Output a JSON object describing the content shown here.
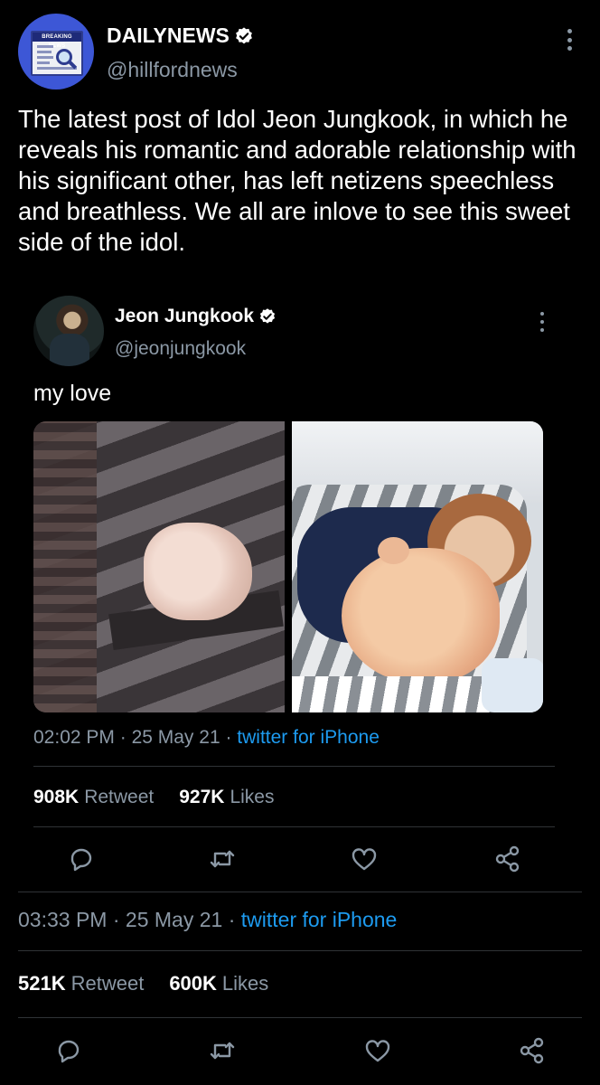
{
  "outer_tweet": {
    "avatar_banner": "BREAKING NEWS",
    "display_name": "DAILYNEWS",
    "handle": "@hillfordnews",
    "text": "The latest post of Idol Jeon Jungkook, in which he reveals his romantic and adorable relationship with his significant other, has left netizens speechless and breathless. We all are inlove to see this sweet side of the idol.",
    "time": "03:33 PM",
    "date": "25 May 21",
    "source": "twitter for iPhone",
    "retweet_count": "521K",
    "retweet_label": "Retweet",
    "like_count": "600K",
    "like_label": "Likes"
  },
  "quoted_tweet": {
    "display_name": "Jeon Jungkook",
    "handle": "@jeonjungkook",
    "text": "my love",
    "time": "02:02 PM",
    "date": "25 May 21",
    "source": "twitter for iPhone",
    "retweet_count": "908K",
    "retweet_label": "Retweet",
    "like_count": "927K",
    "like_label": "Likes"
  },
  "icons": [
    "verified-badge-icon",
    "more-options-icon",
    "reply-icon",
    "retweet-icon",
    "like-icon",
    "share-icon"
  ],
  "colors": {
    "background": "#000000",
    "text": "#ffffff",
    "secondary_text": "#8b98a5",
    "link": "#1d9bf0",
    "divider": "#2f3336"
  }
}
